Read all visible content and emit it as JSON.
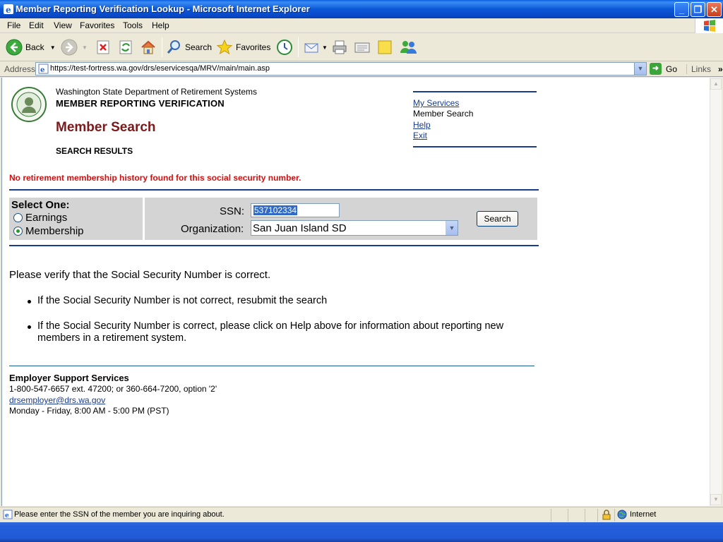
{
  "window": {
    "title": "Member Reporting Verification Lookup - Microsoft Internet Explorer",
    "controls": {
      "minimize": "_",
      "restore": "❐",
      "close": "✕"
    }
  },
  "menu": [
    "File",
    "Edit",
    "View",
    "Favorites",
    "Tools",
    "Help"
  ],
  "toolbar": {
    "back": "Back",
    "search": "Search",
    "favorites": "Favorites"
  },
  "address": {
    "label": "Address",
    "url": "https://test-fortress.wa.gov/drs/eservicesqa/MRV/main/main.asp",
    "go": "Go",
    "links": "Links"
  },
  "header": {
    "agency": "Washington State Department of Retirement Systems",
    "app_title": "MEMBER REPORTING VERIFICATION",
    "page_title": "Member Search",
    "sub_title": "SEARCH RESULTS"
  },
  "nav": {
    "my_services": "My Services",
    "member_search": "Member Search",
    "help": "Help",
    "exit": "Exit"
  },
  "error_message": "No retirement membership history found for this social security number.",
  "search": {
    "select_one": "Select One:",
    "earnings": "Earnings",
    "membership": "Membership",
    "selected": "Membership",
    "ssn_label": "SSN:",
    "ssn_value": "537102334",
    "org_label": "Organization:",
    "org_value": "San Juan Island SD",
    "button": "Search"
  },
  "verify": {
    "intro": "Please verify that the Social Security Number is correct.",
    "bullets": [
      "If the Social Security Number is not correct, resubmit the search",
      "If the Social Security Number is correct, please click on Help above for information about reporting new members in a retirement system."
    ]
  },
  "support": {
    "title": "Employer Support Services",
    "phone": "1-800-547-6657 ext. 47200; or 360-664-7200, option '2'",
    "email": "drsemployer@drs.wa.gov",
    "hours": "Monday - Friday, 8:00 AM - 5:00 PM (PST)"
  },
  "status": {
    "text": "Please enter the SSN of the member you are inquiring about.",
    "zone": "Internet"
  },
  "colors": {
    "title_red": "#7A1A1A",
    "error_red": "#D01010",
    "rule_blue": "#1A3C8C",
    "panel_gray": "#D4D4D4"
  }
}
